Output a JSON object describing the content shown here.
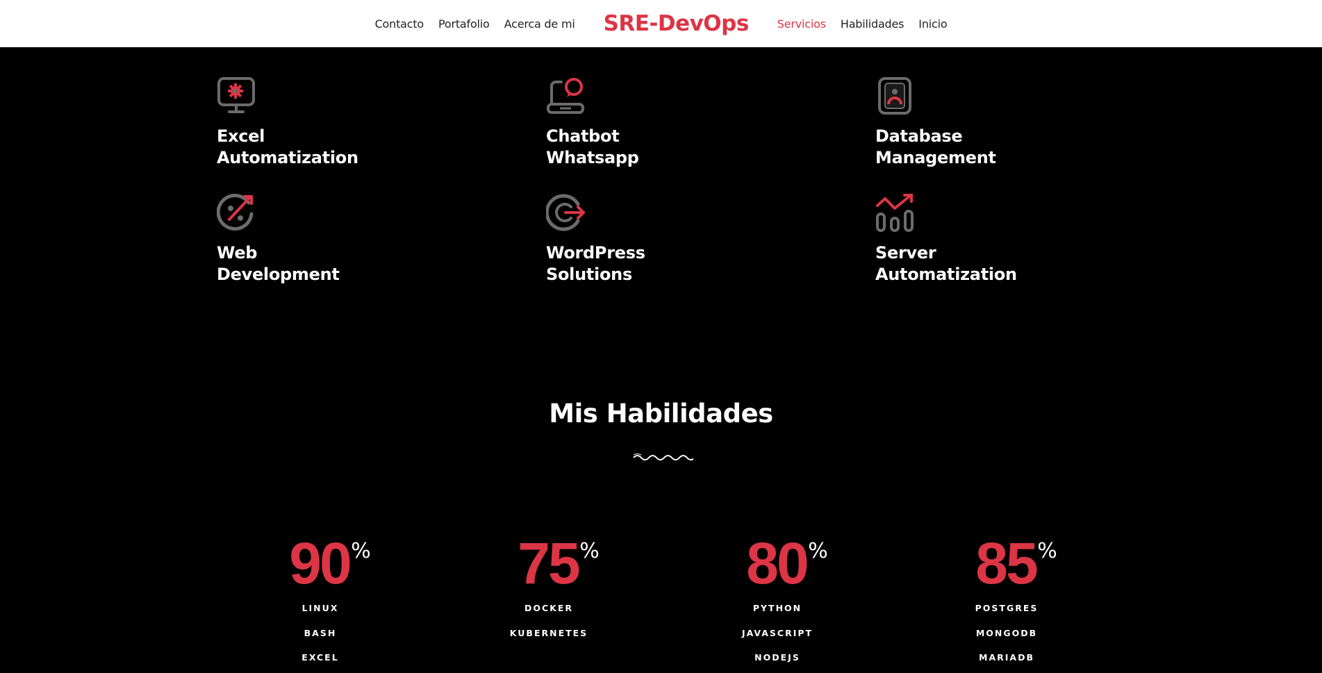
{
  "nav": {
    "left_links": [
      "Contacto",
      "Portafolio",
      "Acerca de mi"
    ],
    "brand": "SRE-DevOps",
    "right_links": [
      "Servicios",
      "Habilidades",
      "Inicio"
    ],
    "active": "Servicios"
  },
  "colors": {
    "accent": "#dc3545",
    "background": "#000000",
    "navbar": "#ffffff",
    "icon_gray": "#6b6b6b"
  },
  "services": [
    {
      "title": "Excel\nAutomatization",
      "icon": "monitor-gear-icon"
    },
    {
      "title": "Chatbot\nWhatsapp",
      "icon": "laptop-chat-icon"
    },
    {
      "title": "Database\nManagement",
      "icon": "user-badge-icon"
    },
    {
      "title": "Web\nDevelopment",
      "icon": "percent-badge-icon"
    },
    {
      "title": "WordPress\nSolutions",
      "icon": "target-arrow-icon"
    },
    {
      "title": "Server\nAutomatization",
      "icon": "chart-growth-icon"
    }
  ],
  "skills": {
    "title": "Mis Habilidades",
    "columns": [
      {
        "value": "90",
        "unit": "%",
        "items": [
          "LINUX",
          "BASH",
          "EXCEL"
        ]
      },
      {
        "value": "75",
        "unit": "%",
        "items": [
          "DOCKER",
          "KUBERNETES"
        ]
      },
      {
        "value": "80",
        "unit": "%",
        "items": [
          "PYTHON",
          "JAVASCRIPT",
          "NODEJS"
        ]
      },
      {
        "value": "85",
        "unit": "%",
        "items": [
          "POSTGRES",
          "MONGODB",
          "MARIADB"
        ]
      }
    ]
  }
}
